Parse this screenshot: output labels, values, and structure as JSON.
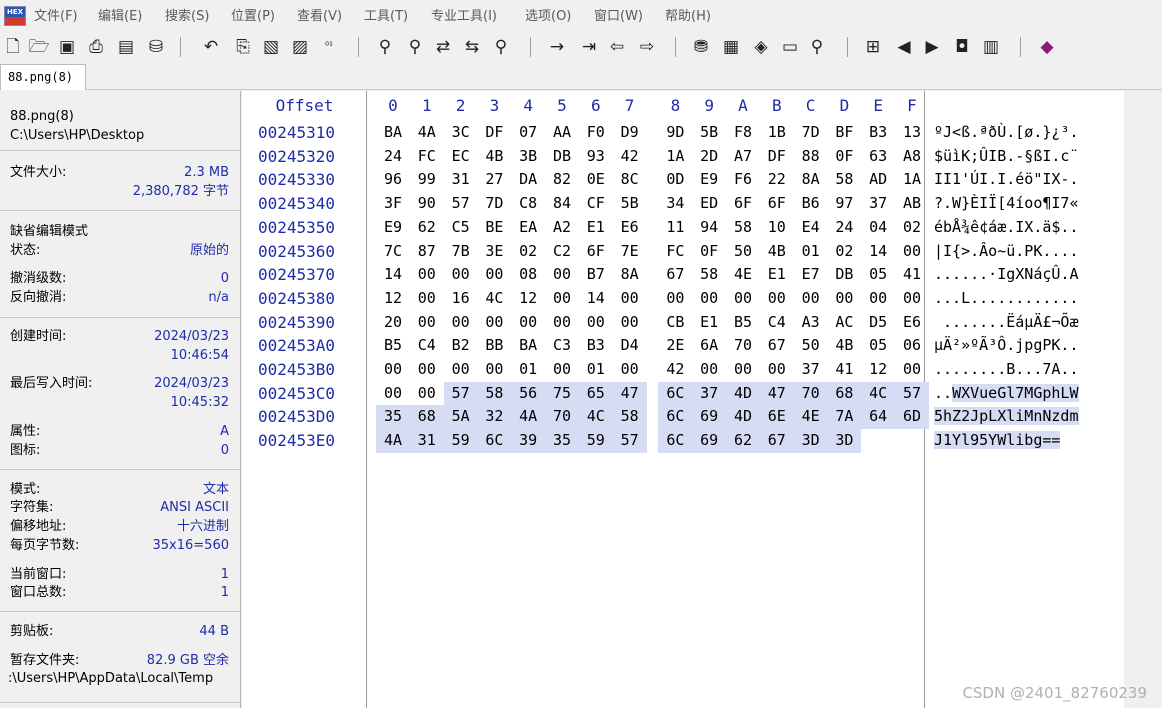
{
  "menubar": {
    "logo_text": "HEX",
    "items": [
      "文件(F)",
      "编辑(E)",
      "搜索(S)",
      "位置(P)",
      "查看(V)",
      "工具(T)",
      "专业工具(I)",
      "选项(O)",
      "窗口(W)",
      "帮助(H)"
    ]
  },
  "toolbar": {
    "icons": [
      "new-file-icon",
      "open-folder-icon",
      "save-icon",
      "print-icon",
      "properties-icon",
      "open-disk-icon",
      "undo-icon",
      "copy-icon",
      "paste-icon",
      "paste-special-icon",
      "hex-convert-icon",
      "find-icon",
      "find-hex-icon",
      "replace-icon",
      "replace-hex-icon",
      "find-next-icon",
      "goto-icon",
      "goto-offset-icon",
      "back-icon",
      "forward-icon",
      "disk-editor-icon",
      "ram-editor-icon",
      "analyze-icon",
      "calculator-icon",
      "zoom-icon",
      "template-icon",
      "prev-icon",
      "next-icon",
      "snapshot-icon",
      "table-icon",
      "help-book-icon"
    ]
  },
  "tab": {
    "label": "88.png(8)"
  },
  "panel": {
    "file_name": "88.png(8)",
    "file_path": "C:\\Users\\HP\\Desktop",
    "size_label": "文件大小:",
    "size_value": "2.3 MB",
    "size_bytes": "2,380,782 字节",
    "edit_mode_label": "缺省编辑模式",
    "state_label": "状态:",
    "state_value": "原始的",
    "undo_level_label": "撤消级数:",
    "undo_level_value": "0",
    "redo_label": "反向撤消:",
    "redo_value": "n/a",
    "created_label": "创建时间:",
    "created_date": "2024/03/23",
    "created_time": "10:46:54",
    "modified_label": "最后写入时间:",
    "modified_date": "2024/03/23",
    "modified_time": "10:45:32",
    "attr_label": "属性:",
    "attr_value": "A",
    "icon_label": "图标:",
    "icon_value": "0",
    "mode_label": "模式:",
    "mode_value": "文本",
    "charset_label": "字符集:",
    "charset_value": "ANSI ASCII",
    "offset_label": "偏移地址:",
    "offset_value": "十六进制",
    "bpp_label": "每页字节数:",
    "bpp_value": "35x16=560",
    "cur_window_label": "当前窗口:",
    "cur_window_value": "1",
    "total_window_label": "窗口总数:",
    "total_window_value": "1",
    "clipboard_label": "剪贴板:",
    "clipboard_value": "44 B",
    "temp_label": "暂存文件夹:",
    "temp_value": "82.9 GB 空余",
    "temp_path": ":\\Users\\HP\\AppData\\Local\\Temp"
  },
  "hex": {
    "offset_header": "Offset",
    "column_headers": [
      "0",
      "1",
      "2",
      "3",
      "4",
      "5",
      "6",
      "7",
      "8",
      "9",
      "A",
      "B",
      "C",
      "D",
      "E",
      "F"
    ],
    "rows": [
      {
        "offset": "00245310",
        "bytes": [
          "BA",
          "4A",
          "3C",
          "DF",
          "07",
          "AA",
          "F0",
          "D9",
          "9D",
          "5B",
          "F8",
          "1B",
          "7D",
          "BF",
          "B3",
          "13"
        ],
        "ascii": "ºJ<ß.ªðÙ.[ø.}¿³."
      },
      {
        "offset": "00245320",
        "bytes": [
          "24",
          "FC",
          "EC",
          "4B",
          "3B",
          "DB",
          "93",
          "42",
          "1A",
          "2D",
          "A7",
          "DF",
          "88",
          "0F",
          "63",
          "A8"
        ],
        "ascii": "$üìK;ÛIB.-§ßI.c¨"
      },
      {
        "offset": "00245330",
        "bytes": [
          "96",
          "99",
          "31",
          "27",
          "DA",
          "82",
          "0E",
          "8C",
          "0D",
          "E9",
          "F6",
          "22",
          "8A",
          "58",
          "AD",
          "1A"
        ],
        "ascii": "II1'ÚI.I.éö\"IX-."
      },
      {
        "offset": "00245340",
        "bytes": [
          "3F",
          "90",
          "57",
          "7D",
          "C8",
          "84",
          "CF",
          "5B",
          "34",
          "ED",
          "6F",
          "6F",
          "B6",
          "97",
          "37",
          "AB"
        ],
        "ascii": "?.W}ÈIÏ[4íoo¶I7«"
      },
      {
        "offset": "00245350",
        "bytes": [
          "E9",
          "62",
          "C5",
          "BE",
          "EA",
          "A2",
          "E1",
          "E6",
          "11",
          "94",
          "58",
          "10",
          "E4",
          "24",
          "04",
          "02"
        ],
        "ascii": "ébÅ¾ê¢áæ.IX.ä$.."
      },
      {
        "offset": "00245360",
        "bytes": [
          "7C",
          "87",
          "7B",
          "3E",
          "02",
          "C2",
          "6F",
          "7E",
          "FC",
          "0F",
          "50",
          "4B",
          "01",
          "02",
          "14",
          "00"
        ],
        "ascii": "|I{>.Âo~ü.PK...."
      },
      {
        "offset": "00245370",
        "bytes": [
          "14",
          "00",
          "00",
          "00",
          "08",
          "00",
          "B7",
          "8A",
          "67",
          "58",
          "4E",
          "E1",
          "E7",
          "DB",
          "05",
          "41"
        ],
        "ascii": "......·IgXNáçÛ.A"
      },
      {
        "offset": "00245380",
        "bytes": [
          "12",
          "00",
          "16",
          "4C",
          "12",
          "00",
          "14",
          "00",
          "00",
          "00",
          "00",
          "00",
          "00",
          "00",
          "00",
          "00"
        ],
        "ascii": "...L............"
      },
      {
        "offset": "00245390",
        "bytes": [
          "20",
          "00",
          "00",
          "00",
          "00",
          "00",
          "00",
          "00",
          "CB",
          "E1",
          "B5",
          "C4",
          "A3",
          "AC",
          "D5",
          "E6"
        ],
        "ascii": " .......ËáµÄ£¬Õæ"
      },
      {
        "offset": "002453A0",
        "bytes": [
          "B5",
          "C4",
          "B2",
          "BB",
          "BA",
          "C3",
          "B3",
          "D4",
          "2E",
          "6A",
          "70",
          "67",
          "50",
          "4B",
          "05",
          "06"
        ],
        "ascii": "µÄ²»ºÃ³Ô.jpgPK.."
      },
      {
        "offset": "002453B0",
        "bytes": [
          "00",
          "00",
          "00",
          "00",
          "01",
          "00",
          "01",
          "00",
          "42",
          "00",
          "00",
          "00",
          "37",
          "41",
          "12",
          "00"
        ],
        "ascii": "........B...7A.."
      },
      {
        "offset": "002453C0",
        "bytes": [
          "00",
          "00",
          "57",
          "58",
          "56",
          "75",
          "65",
          "47",
          "6C",
          "37",
          "4D",
          "47",
          "70",
          "68",
          "4C",
          "57"
        ],
        "ascii": "..WXVueGl7MGphLW"
      },
      {
        "offset": "002453D0",
        "bytes": [
          "35",
          "68",
          "5A",
          "32",
          "4A",
          "70",
          "4C",
          "58",
          "6C",
          "69",
          "4D",
          "6E",
          "4E",
          "7A",
          "64",
          "6D"
        ],
        "ascii": "5hZ2JpLXliMnNzdm"
      },
      {
        "offset": "002453E0",
        "bytes": [
          "4A",
          "31",
          "59",
          "6C",
          "39",
          "35",
          "59",
          "57",
          "6C",
          "69",
          "62",
          "67",
          "3D",
          "3D"
        ],
        "ascii": "J1Yl95YWlibg=="
      }
    ]
  },
  "watermark": "CSDN @2401_82760239",
  "colors": {
    "offset_blue": "#1d2ca8",
    "selection": "#d7dcf5",
    "panel_value": "#1d2ca8"
  }
}
